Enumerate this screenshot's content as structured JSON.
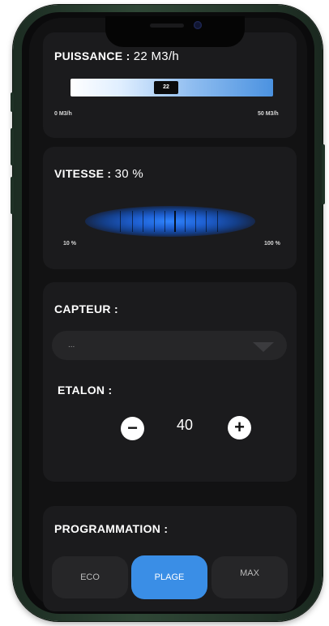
{
  "power": {
    "label": "PUISSANCE :",
    "value_text": "22 M3/h",
    "current": 22,
    "current_text": "22",
    "min_label": "0 M3/h",
    "max_label": "50 M3/h",
    "fill_fraction": 0.44
  },
  "speed": {
    "label": "VITESSE :",
    "value_text": "30 %",
    "min_label": "10 %",
    "max_label": "100 %",
    "level_fraction": 0.3
  },
  "sensor": {
    "label": "CAPTEUR :",
    "selected": "..."
  },
  "etalon": {
    "label": "ETALON :",
    "value": "40",
    "minus_symbol": "−",
    "plus_symbol": "+"
  },
  "program": {
    "label": "PROGRAMMATION :",
    "options": [
      "ECO",
      "PLAGE",
      "MAX"
    ],
    "selected": "PLAGE"
  },
  "colors": {
    "accent": "#3a8ee6",
    "card": "#1b1b1d",
    "background": "#121213",
    "frame": "#2f4736"
  },
  "icons": [
    "minus-icon",
    "plus-icon",
    "chevron-down-icon"
  ]
}
